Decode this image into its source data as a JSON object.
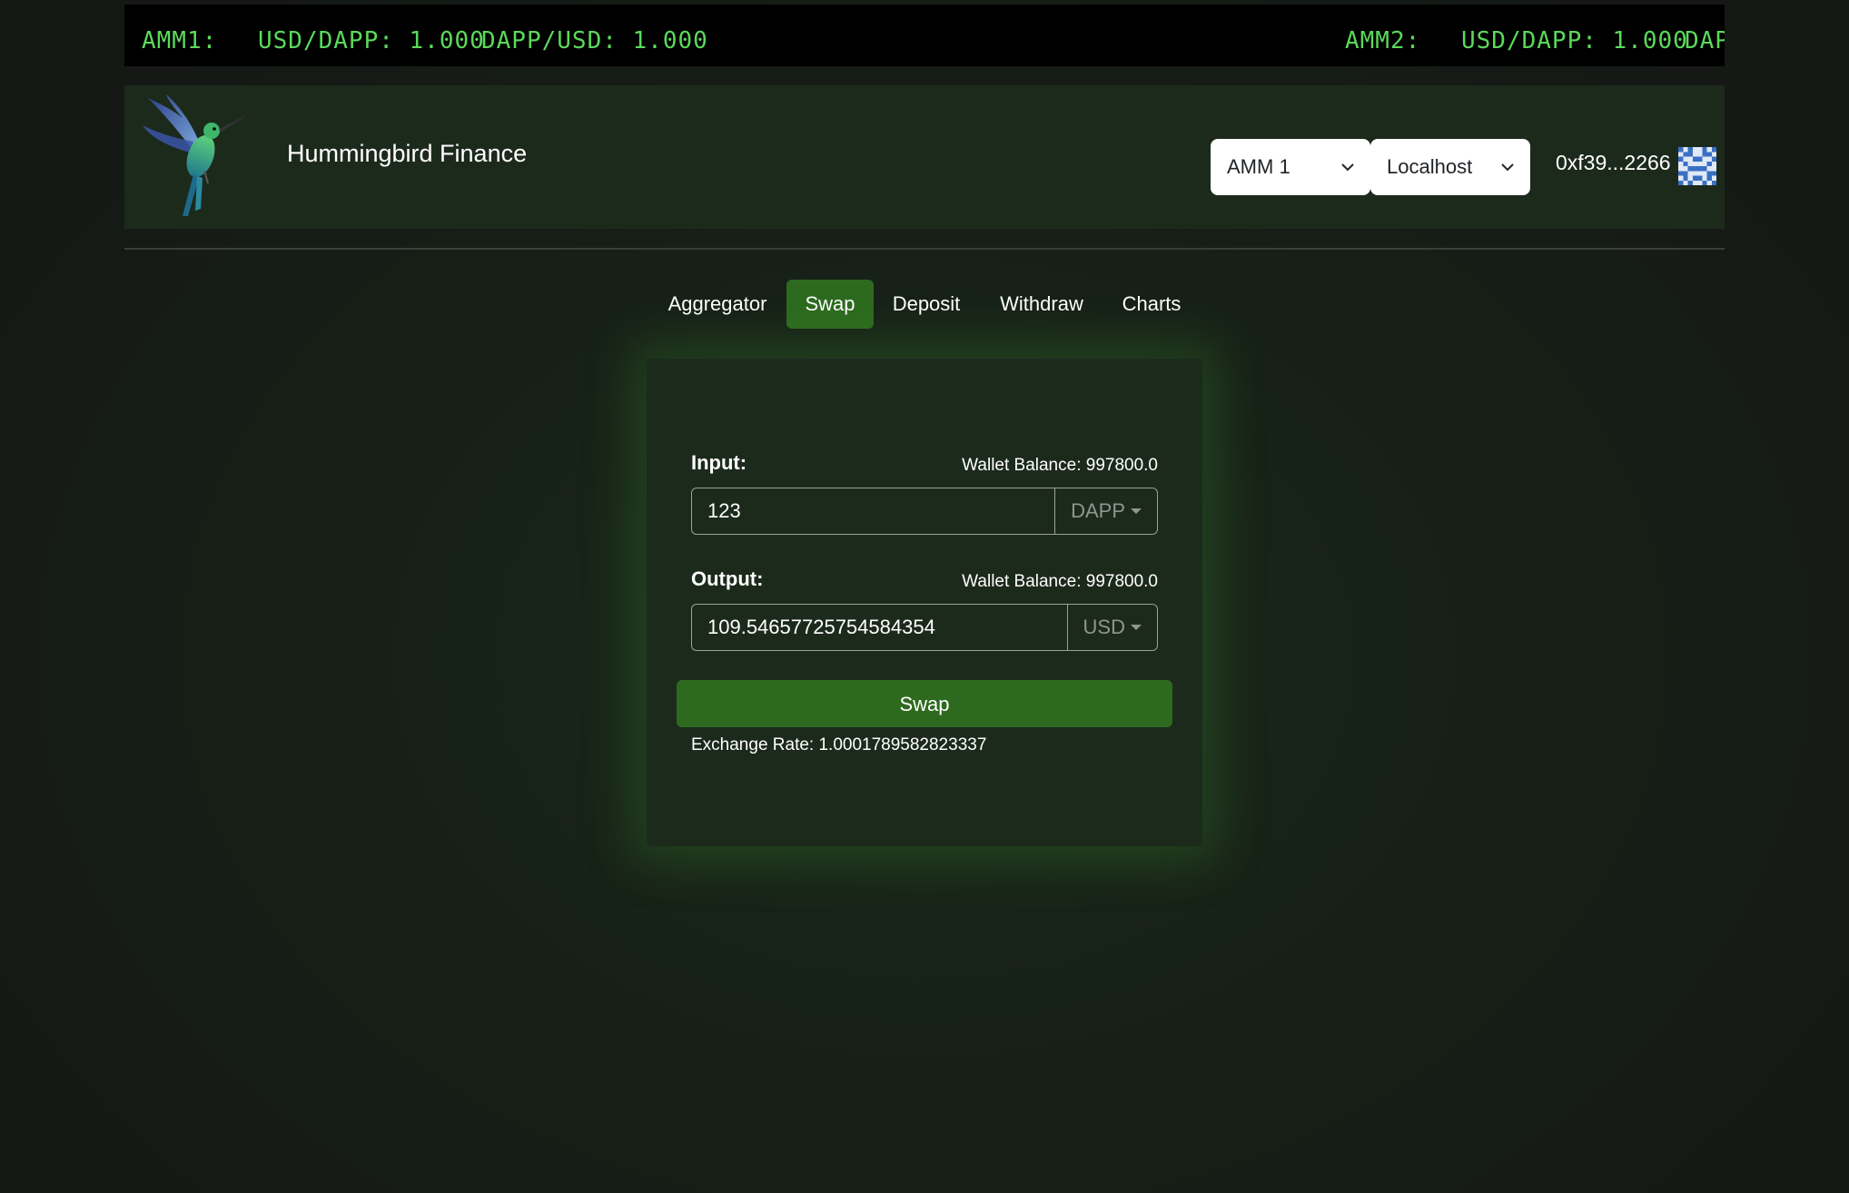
{
  "ticker": {
    "amm1_label": "AMM1:",
    "amm1_usd_dapp": "USD/DAPP: 1.000",
    "amm1_dapp_usd": "DAPP/USD: 1.000",
    "amm2_label": "AMM2:",
    "amm2_usd_dapp": "USD/DAPP: 1.000",
    "amm2_dapp_partial": "DAP"
  },
  "header": {
    "brand": "Hummingbird Finance",
    "amm_select": "AMM 1",
    "network_select": "Localhost",
    "account": "0xf39...2266"
  },
  "nav": {
    "tabs": [
      {
        "label": "Aggregator"
      },
      {
        "label": "Swap",
        "active": true
      },
      {
        "label": "Deposit"
      },
      {
        "label": "Withdraw"
      },
      {
        "label": "Charts"
      }
    ]
  },
  "swap": {
    "input_label": "Input:",
    "input_balance": "Wallet Balance: 997800.0",
    "input_value": "123",
    "input_token": "DAPP",
    "output_label": "Output:",
    "output_balance": "Wallet Balance: 997800.0",
    "output_value": "109.54657725754584354",
    "output_token": "USD",
    "button_label": "Swap",
    "exchange_rate": "Exchange Rate: 1.0001789582823337"
  },
  "colors": {
    "accent": "#2d6a1f",
    "ticker_text": "#5bd95b",
    "panel": "#1c2a1c"
  }
}
